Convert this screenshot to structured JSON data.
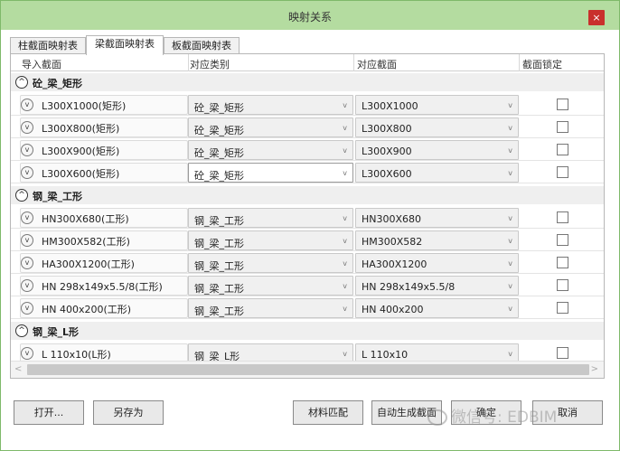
{
  "window": {
    "title": "映射关系",
    "close_glyph": "×"
  },
  "tabs": [
    {
      "label": "柱截面映射表",
      "active": false
    },
    {
      "label": "梁截面映射表",
      "active": true
    },
    {
      "label": "板截面映射表",
      "active": false
    }
  ],
  "columns": {
    "import_section": "导入截面",
    "category": "对应类别",
    "section": "对应截面",
    "lock": "截面锁定"
  },
  "groups": [
    {
      "label": "砼_梁_矩形",
      "toggle_glyph": "^",
      "rows": [
        {
          "name": "L300X1000(矩形)",
          "category": "砼_梁_矩形",
          "section": "L300X1000",
          "locked": false
        },
        {
          "name": "L300X800(矩形)",
          "category": "砼_梁_矩形",
          "section": "L300X800",
          "locked": false
        },
        {
          "name": "L300X900(矩形)",
          "category": "砼_梁_矩形",
          "section": "L300X900",
          "locked": false
        },
        {
          "name": "L300X600(矩形)",
          "category": "砼_梁_矩形",
          "section": "L300X600",
          "locked": false
        }
      ]
    },
    {
      "label": "钢_梁_工形",
      "toggle_glyph": "^",
      "rows": [
        {
          "name": "HN300X680(工形)",
          "category": "钢_梁_工形",
          "section": "HN300X680",
          "locked": false
        },
        {
          "name": "HM300X582(工形)",
          "category": "钢_梁_工形",
          "section": "HM300X582",
          "locked": false
        },
        {
          "name": "HA300X1200(工形)",
          "category": "钢_梁_工形",
          "section": "HA300X1200",
          "locked": false
        },
        {
          "name": "HN 298x149x5.5/8(工形)",
          "category": "钢_梁_工形",
          "section": "HN 298x149x5.5/8",
          "locked": false
        },
        {
          "name": "HN 400x200(工形)",
          "category": "钢_梁_工形",
          "section": "HN 400x200",
          "locked": false
        }
      ]
    },
    {
      "label": "钢_梁_L形",
      "toggle_glyph": "^",
      "rows": [
        {
          "name": "L 110x10(L形)",
          "category": "钢_梁_L形",
          "section": "L 110x10",
          "locked": false
        }
      ]
    }
  ],
  "icons": {
    "row_expand": "chevron-down-icon",
    "combo_arrow": "chevron-down-icon",
    "group_collapse": "chevron-up-icon"
  },
  "glyphs": {
    "row_toggle": "v",
    "combo_arrow": "v",
    "scroll_left": "<",
    "scroll_right": ">"
  },
  "buttons": {
    "open": "打开...",
    "save_as": "另存为",
    "material_match": "材料匹配",
    "auto_generate": "自动生成截面",
    "ok": "确定",
    "cancel": "取消"
  },
  "watermark": "微信号: EDBIM"
}
